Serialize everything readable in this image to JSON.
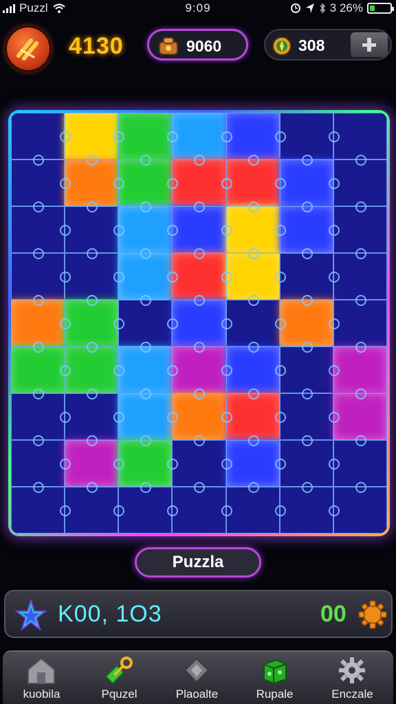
{
  "status_bar": {
    "carrier": "Puzzl",
    "time": "9:09",
    "battery": "3 26%",
    "battery_level": 0.26
  },
  "hud": {
    "score": "4130",
    "coins": "9060",
    "gems": "308"
  },
  "board": {
    "columns": 7,
    "rows": 9,
    "colors": {
      "grid": "#78b4ff",
      "base": "#0b0b38",
      "blue": "#2a3cff",
      "yellow": "#ffd400",
      "green": "#22cc33",
      "orange": "#ff7a10",
      "red": "#ff3030",
      "cyan": "#1ea0ff",
      "magenta": "#c020c0",
      "navy": "#1a1a90"
    },
    "tiles": [
      [
        "navy",
        "yellow",
        "green",
        "cyan",
        "blue",
        "navy",
        "navy"
      ],
      [
        "navy",
        "orange",
        "green",
        "red",
        "red",
        "blue",
        "navy"
      ],
      [
        "navy",
        "navy",
        "cyan",
        "blue",
        "yellow",
        "blue",
        "navy"
      ],
      [
        "navy",
        "navy",
        "cyan",
        "red",
        "yellow",
        "navy",
        "navy"
      ],
      [
        "orange",
        "green",
        "navy",
        "blue",
        "navy",
        "orange",
        "navy"
      ],
      [
        "green",
        "green",
        "cyan",
        "magenta",
        "blue",
        "navy",
        "magenta"
      ],
      [
        "navy",
        "navy",
        "cyan",
        "orange",
        "red",
        "navy",
        "magenta"
      ],
      [
        "navy",
        "magenta",
        "green",
        "navy",
        "blue",
        "navy",
        "navy"
      ],
      [
        "navy",
        "navy",
        "navy",
        "navy",
        "navy",
        "navy",
        "navy"
      ]
    ]
  },
  "puzzle_label": "Puzzla",
  "stats": {
    "value": "K00, 1O3",
    "count": "00"
  },
  "nav": [
    {
      "label": "kuobila",
      "icon": "home-icon"
    },
    {
      "label": "Pquzel",
      "icon": "key-icon"
    },
    {
      "label": "Plaoalte",
      "icon": "diamond-icon"
    },
    {
      "label": "Rupale",
      "icon": "cube-icon"
    },
    {
      "label": "Enczale",
      "icon": "gear-icon"
    }
  ]
}
